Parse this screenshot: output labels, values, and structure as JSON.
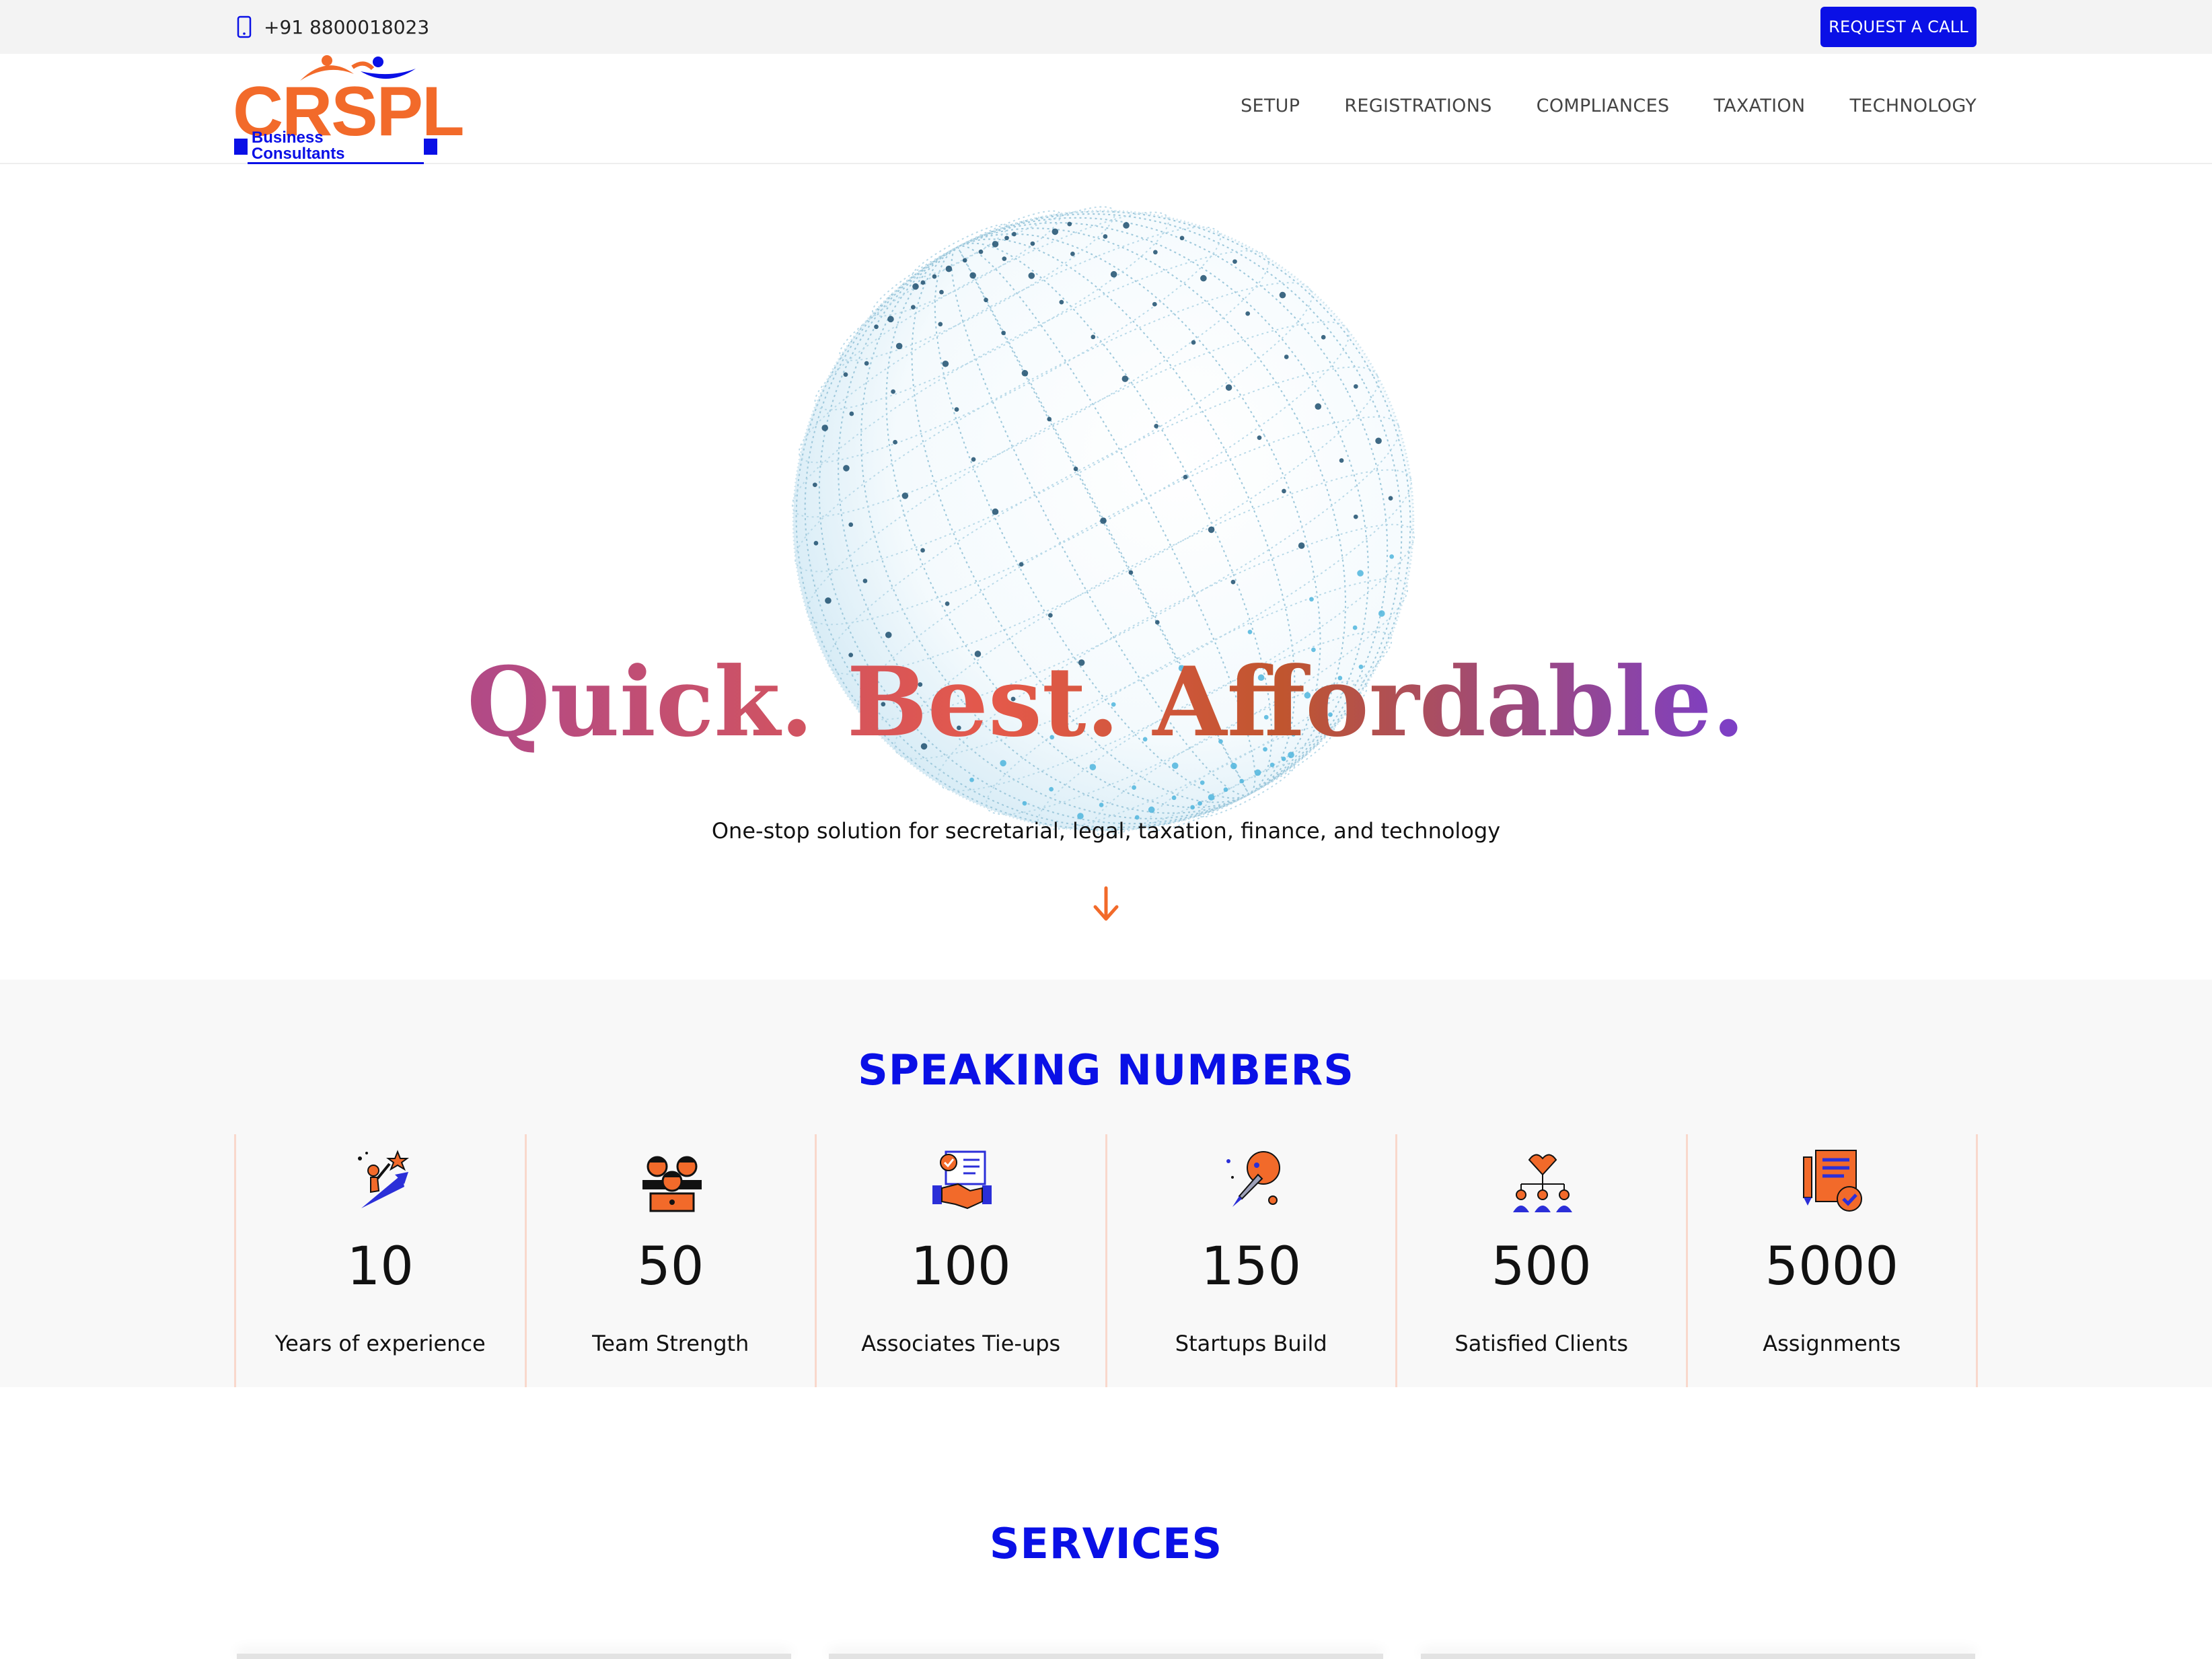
{
  "topbar": {
    "phone": "+91 8800018023",
    "request_button": "REQUEST A CALL"
  },
  "header": {
    "logo_text": "CRSPL",
    "logo_subtitle": "Business Consultants",
    "nav": [
      "SETUP",
      "REGISTRATIONS",
      "COMPLIANCES",
      "TAXATION",
      "TECHNOLOGY"
    ]
  },
  "hero": {
    "tagline_parts": [
      "Quick.",
      "Best.",
      "Affordable."
    ],
    "subtitle": "One-stop solution for secretarial, legal, taxation, finance, and technology"
  },
  "numbers": {
    "title": "SPEAKING NUMBERS",
    "stats": [
      {
        "icon": "climber-icon",
        "value": "10",
        "label": "Years of experience"
      },
      {
        "icon": "team-icon",
        "value": "50",
        "label": "Team Strength"
      },
      {
        "icon": "handshake-document-icon",
        "value": "100",
        "label": "Associates Tie-ups"
      },
      {
        "icon": "rocket-icon",
        "value": "150",
        "label": "Startups Build"
      },
      {
        "icon": "clients-network-icon",
        "value": "500",
        "label": "Satisfied Clients"
      },
      {
        "icon": "assignment-check-icon",
        "value": "5000",
        "label": "Assignments"
      }
    ]
  },
  "services": {
    "title": "SERVICES"
  },
  "colors": {
    "brand_blue": "#0a10e6",
    "brand_orange": "#f26a2a"
  }
}
